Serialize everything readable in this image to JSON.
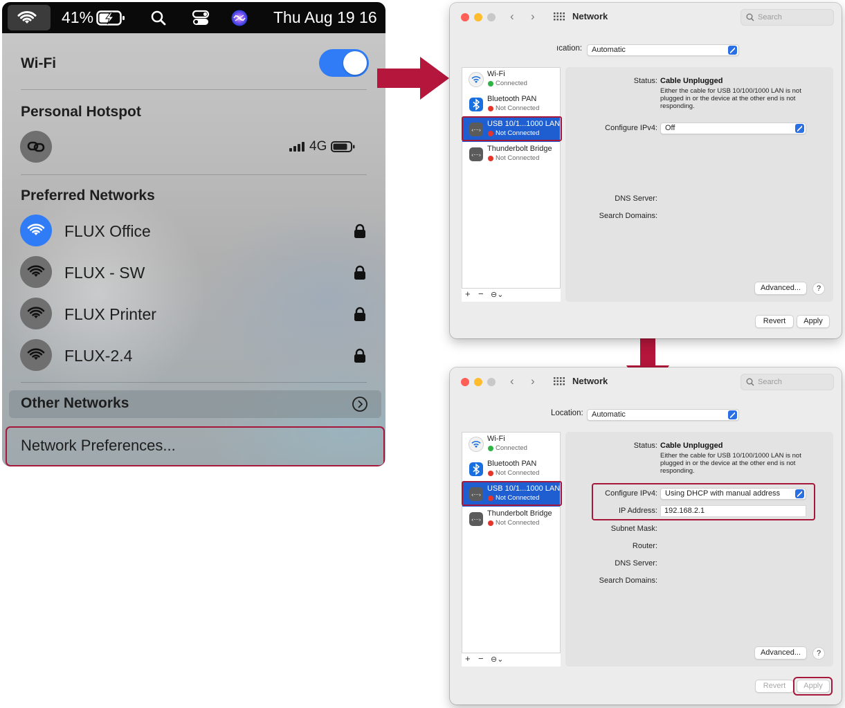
{
  "menubar": {
    "battery_text": "41%",
    "clock": "Thu Aug 19 16"
  },
  "wifi_menu": {
    "wifi_label": "Wi-Fi",
    "wifi_on": true,
    "hotspot_title": "Personal Hotspot",
    "hotspot_signal": "4G",
    "preferred_title": "Preferred Networks",
    "networks": [
      {
        "name": "FLUX Office",
        "connected": true
      },
      {
        "name": "FLUX - SW",
        "connected": false
      },
      {
        "name": "FLUX Printer",
        "connected": false
      },
      {
        "name": "FLUX-2.4",
        "connected": false
      }
    ],
    "other_networks": "Other Networks",
    "network_preferences": "Network Preferences..."
  },
  "window1": {
    "title": "Network",
    "search_placeholder": "Search",
    "location_label": "Location:",
    "location_label_visible": "ıcation:",
    "location_value": "Automatic",
    "services": [
      {
        "name": "Wi-Fi",
        "status": "Connected",
        "status_color": "#2fb344"
      },
      {
        "name": "Bluetooth PAN",
        "status": "Not Connected",
        "status_color": "#e5352b"
      },
      {
        "name": "USB 10/1...1000 LAN",
        "status": "Not Connected",
        "status_color": "#e5352b"
      },
      {
        "name": "Thunderbolt Bridge",
        "status": "Not Connected",
        "status_color": "#e5352b"
      }
    ],
    "status_label": "Status:",
    "status_value": "Cable Unplugged",
    "status_note": "Either the cable for USB 10/100/1000 LAN is not plugged in or the device at the other end is not responding.",
    "configure_label": "Configure IPv4:",
    "configure_value": "Off",
    "dns_label": "DNS Server:",
    "search_domains_label": "Search Domains:",
    "advanced": "Advanced...",
    "help": "?",
    "revert": "Revert",
    "apply": "Apply",
    "list_controls": [
      "+",
      "−",
      "⊖⌄"
    ]
  },
  "window2": {
    "title": "Network",
    "search_placeholder": "Search",
    "location_label": "Location:",
    "location_value": "Automatic",
    "services": [
      {
        "name": "Wi-Fi",
        "status": "Connected",
        "status_color": "#2fb344"
      },
      {
        "name": "Bluetooth PAN",
        "status": "Not Connected",
        "status_color": "#e5352b"
      },
      {
        "name": "USB 10/1...1000 LAN",
        "status": "Not Connected",
        "status_color": "#e5352b"
      },
      {
        "name": "Thunderbolt Bridge",
        "status": "Not Connected",
        "status_color": "#e5352b"
      }
    ],
    "status_label": "Status:",
    "status_value": "Cable Unplugged",
    "status_note": "Either the cable for USB 10/100/1000 LAN is not plugged in or the device at the other end is not responding.",
    "configure_label": "Configure IPv4:",
    "configure_value": "Using DHCP with manual address",
    "ip_label": "IP Address:",
    "ip_value": "192.168.2.1",
    "subnet_label": "Subnet Mask:",
    "router_label": "Router:",
    "dns_label": "DNS Server:",
    "search_domains_label": "Search Domains:",
    "advanced": "Advanced...",
    "help": "?",
    "revert": "Revert",
    "apply": "Apply",
    "list_controls": [
      "+",
      "−",
      "⊖⌄"
    ]
  },
  "colors": {
    "accent_blue": "#2f7cf6",
    "highlight_red": "#a5173b",
    "selection_blue": "#1e5ed1"
  }
}
